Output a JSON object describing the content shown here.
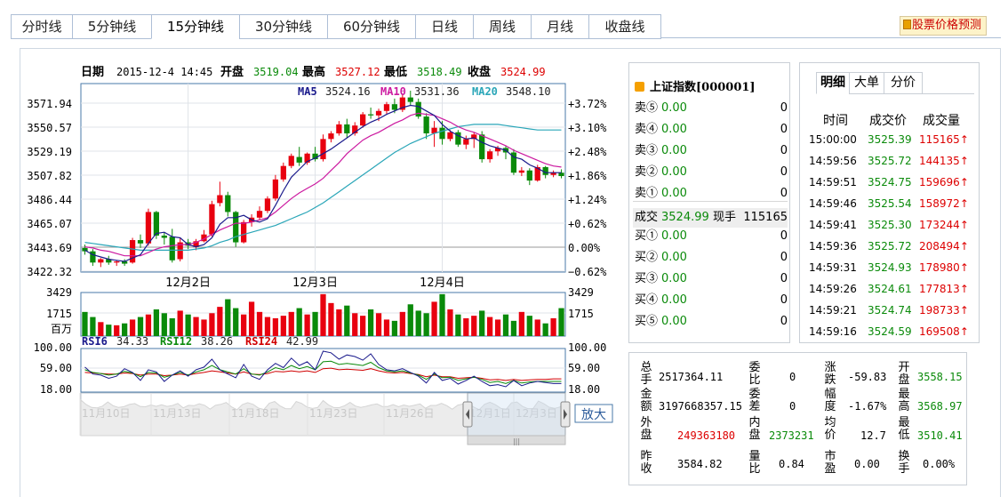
{
  "tabs": [
    "分时线",
    "5分钟线",
    "15分钟线",
    "30分钟线",
    "60分钟线",
    "日线",
    "周线",
    "月线",
    "收盘线"
  ],
  "active_tab": 2,
  "predict_link": "股票价格预测",
  "header": {
    "date_label": "日期",
    "date_value": "2015-12-4 14:45",
    "open_label": "开盘",
    "open_value": "3519.04",
    "high_label": "最高",
    "high_value": "3527.12",
    "low_label": "最低",
    "low_value": "3518.49",
    "close_label": "收盘",
    "close_value": "3524.99"
  },
  "ma_legend": [
    {
      "name": "MA5",
      "value": "3524.16",
      "color": "#1a1a8c"
    },
    {
      "name": "MA10",
      "value": "3531.36",
      "color": "#cc1aa0"
    },
    {
      "name": "MA20",
      "value": "3548.10",
      "color": "#2aa6b8"
    }
  ],
  "rsi_legend": [
    {
      "name": "RSI6",
      "value": "34.33",
      "color": "#1a1a8c"
    },
    {
      "name": "RSI12",
      "value": "38.26",
      "color": "#0a8a0a"
    },
    {
      "name": "RSI24",
      "value": "42.99",
      "color": "#d00000"
    }
  ],
  "colors": {
    "up": "#e8000f",
    "down": "#0a8a0a",
    "grid": "#dfe3e8",
    "frame": "#4a7aa8",
    "zero": "#999999"
  },
  "chart_data": [
    {
      "type": "candlestick",
      "name": "price",
      "y_ticks": [
        "3571.94",
        "3550.57",
        "3529.19",
        "3507.82",
        "3486.44",
        "3465.07",
        "3443.69",
        "3422.32"
      ],
      "y_ticks_right": [
        "+3.72%",
        "+3.10%",
        "+2.48%",
        "+1.86%",
        "+1.24%",
        "+0.62%",
        "0.00%",
        "−0.62%"
      ],
      "ylim": [
        3422.32,
        3571.94
      ],
      "x_labels": [
        {
          "label": "12月2日",
          "index": 13
        },
        {
          "label": "12月3日",
          "index": 29
        },
        {
          "label": "12月4日",
          "index": 45
        }
      ],
      "prev_close": 3443.69,
      "ohlc": [
        [
          3443,
          3446,
          3437,
          3440
        ],
        [
          3440,
          3442,
          3427,
          3430
        ],
        [
          3430,
          3434,
          3426,
          3433
        ],
        [
          3433,
          3436,
          3428,
          3430
        ],
        [
          3430,
          3432,
          3427,
          3431
        ],
        [
          3431,
          3433,
          3427,
          3429
        ],
        [
          3430,
          3452,
          3429,
          3450
        ],
        [
          3450,
          3455,
          3443,
          3447
        ],
        [
          3447,
          3478,
          3445,
          3475
        ],
        [
          3475,
          3476,
          3451,
          3454
        ],
        [
          3454,
          3457,
          3446,
          3452
        ],
        [
          3453,
          3460,
          3430,
          3432
        ],
        [
          3433,
          3452,
          3431,
          3448
        ],
        [
          3448,
          3451,
          3442,
          3445
        ],
        [
          3444,
          3451,
          3441,
          3449
        ],
        [
          3449,
          3459,
          3448,
          3455
        ],
        [
          3455,
          3485,
          3453,
          3482
        ],
        [
          3483,
          3502,
          3480,
          3490
        ],
        [
          3490,
          3493,
          3471,
          3475
        ],
        [
          3475,
          3476,
          3444,
          3448
        ],
        [
          3448,
          3468,
          3447,
          3466
        ],
        [
          3466,
          3473,
          3462,
          3470
        ],
        [
          3470,
          3480,
          3468,
          3476
        ],
        [
          3476,
          3489,
          3474,
          3487
        ],
        [
          3487,
          3508,
          3485,
          3504
        ],
        [
          3504,
          3519,
          3502,
          3516
        ],
        [
          3516,
          3527,
          3514,
          3525
        ],
        [
          3524,
          3533,
          3516,
          3519
        ],
        [
          3519,
          3528,
          3517,
          3527
        ],
        [
          3527,
          3533,
          3520,
          3522
        ],
        [
          3522,
          3544,
          3520,
          3540
        ],
        [
          3540,
          3547,
          3537,
          3545
        ],
        [
          3545,
          3556,
          3543,
          3553
        ],
        [
          3553,
          3558,
          3541,
          3545
        ],
        [
          3545,
          3555,
          3543,
          3552
        ],
        [
          3552,
          3564,
          3550,
          3562
        ],
        [
          3562,
          3568,
          3558,
          3561
        ],
        [
          3561,
          3567,
          3556,
          3565
        ],
        [
          3565,
          3573,
          3562,
          3571
        ],
        [
          3571,
          3576,
          3563,
          3566
        ],
        [
          3566,
          3580,
          3564,
          3577
        ],
        [
          3577,
          3583,
          3570,
          3573
        ],
        [
          3573,
          3576,
          3558,
          3560
        ],
        [
          3560,
          3563,
          3540,
          3545
        ],
        [
          3545,
          3556,
          3533,
          3550
        ],
        [
          3550,
          3556,
          3535,
          3540
        ],
        [
          3540,
          3548,
          3538,
          3546
        ],
        [
          3546,
          3548,
          3533,
          3535
        ],
        [
          3535,
          3543,
          3531,
          3540
        ],
        [
          3540,
          3546,
          3532,
          3544
        ],
        [
          3544,
          3547,
          3519,
          3522
        ],
        [
          3522,
          3531,
          3519,
          3529
        ],
        [
          3529,
          3534,
          3525,
          3532
        ],
        [
          3532,
          3534,
          3522,
          3528
        ],
        [
          3528,
          3531,
          3508,
          3510
        ],
        [
          3510,
          3515,
          3507,
          3512
        ],
        [
          3512,
          3514,
          3499,
          3503
        ],
        [
          3503,
          3517,
          3502,
          3515
        ],
        [
          3515,
          3516,
          3505,
          3508
        ],
        [
          3508,
          3512,
          3506,
          3510
        ],
        [
          3510,
          3513,
          3505,
          3507
        ]
      ],
      "ma5": [
        3441,
        3437,
        3435,
        3433,
        3432,
        3431,
        3434,
        3437,
        3447,
        3456,
        3457,
        3453,
        3452,
        3446,
        3444,
        3446,
        3452,
        3464,
        3470,
        3470,
        3472,
        3468,
        3466,
        3469,
        3481,
        3494,
        3506,
        3513,
        3520,
        3523,
        3527,
        3531,
        3536,
        3541,
        3546,
        3551,
        3555,
        3558,
        3562,
        3565,
        3568,
        3570,
        3569,
        3565,
        3561,
        3553,
        3547,
        3543,
        3540,
        3541,
        3537,
        3534,
        3532,
        3530,
        3524,
        3522,
        3517,
        3514,
        3510,
        3510,
        3510
      ],
      "ma10": [
        3444,
        3443,
        3441,
        3440,
        3438,
        3436,
        3436,
        3436,
        3439,
        3442,
        3444,
        3445,
        3446,
        3446,
        3448,
        3451,
        3455,
        3459,
        3462,
        3465,
        3465,
        3466,
        3468,
        3470,
        3475,
        3481,
        3487,
        3492,
        3496,
        3500,
        3505,
        3512,
        3519,
        3527,
        3533,
        3539,
        3543,
        3546,
        3550,
        3554,
        3557,
        3561,
        3563,
        3562,
        3561,
        3558,
        3555,
        3551,
        3548,
        3546,
        3543,
        3540,
        3537,
        3534,
        3530,
        3527,
        3524,
        3521,
        3518,
        3516,
        3515
      ],
      "ma20": [
        3448,
        3447,
        3446,
        3445,
        3444,
        3443,
        3442,
        3441,
        3441,
        3441,
        3441,
        3441,
        3441,
        3441,
        3442,
        3443,
        3445,
        3448,
        3450,
        3453,
        3455,
        3457,
        3459,
        3461,
        3463,
        3466,
        3469,
        3472,
        3475,
        3479,
        3483,
        3488,
        3493,
        3498,
        3503,
        3508,
        3513,
        3518,
        3523,
        3528,
        3532,
        3536,
        3539,
        3542,
        3545,
        3547,
        3549,
        3551,
        3552,
        3553,
        3553,
        3553,
        3553,
        3552,
        3551,
        3550,
        3549,
        3548,
        3548,
        3548,
        3548
      ]
    },
    {
      "type": "bar",
      "name": "volume",
      "y_ticks": [
        "3429",
        "1715",
        "百万"
      ],
      "ylim": [
        0,
        3429
      ],
      "values": [
        1900,
        1500,
        1100,
        900,
        850,
        1000,
        1300,
        1500,
        1700,
        2100,
        1800,
        1400,
        2000,
        1700,
        1500,
        1300,
        1800,
        2300,
        2900,
        2200,
        1700,
        2700,
        1900,
        1500,
        1400,
        1600,
        1900,
        2200,
        1700,
        1900,
        3300,
        2600,
        2100,
        2400,
        1800,
        1600,
        2100,
        1800,
        1300,
        1200,
        1900,
        2500,
        2000,
        1800,
        2700,
        3300,
        2100,
        1700,
        1400,
        1600,
        2000,
        1500,
        1300,
        1700,
        1200,
        1900,
        1600,
        1300,
        1000,
        1400,
        2200
      ]
    },
    {
      "type": "line",
      "name": "rsi",
      "y_ticks": [
        "100.00",
        "59.00",
        "18.00"
      ],
      "ylim": [
        18,
        100
      ],
      "series": [
        {
          "name": "RSI6",
          "values": [
            65,
            52,
            50,
            44,
            48,
            62,
            55,
            40,
            60,
            56,
            38,
            50,
            58,
            48,
            60,
            65,
            80,
            60,
            52,
            45,
            70,
            48,
            42,
            60,
            72,
            64,
            82,
            68,
            75,
            60,
            95,
            92,
            80,
            88,
            85,
            78,
            90,
            70,
            60,
            58,
            62,
            55,
            48,
            35,
            55,
            40,
            44,
            33,
            40,
            48,
            38,
            30,
            32,
            28,
            40,
            30,
            35,
            38,
            36,
            34,
            34
          ]
        },
        {
          "name": "RSI12",
          "values": [
            60,
            55,
            53,
            50,
            52,
            57,
            54,
            47,
            55,
            54,
            46,
            50,
            55,
            50,
            56,
            60,
            68,
            60,
            56,
            52,
            62,
            52,
            50,
            56,
            64,
            60,
            68,
            62,
            66,
            60,
            75,
            76,
            70,
            72,
            70,
            68,
            74,
            64,
            58,
            56,
            58,
            54,
            50,
            42,
            52,
            45,
            46,
            40,
            43,
            46,
            42,
            36,
            38,
            34,
            40,
            35,
            37,
            38,
            38,
            38,
            38
          ]
        },
        {
          "name": "RSI24",
          "values": [
            55,
            54,
            53,
            52,
            52,
            54,
            53,
            50,
            52,
            52,
            49,
            50,
            52,
            50,
            53,
            55,
            58,
            56,
            54,
            52,
            56,
            52,
            51,
            53,
            57,
            56,
            58,
            56,
            58,
            55,
            62,
            63,
            60,
            61,
            60,
            59,
            62,
            58,
            55,
            54,
            55,
            53,
            51,
            47,
            50,
            47,
            47,
            44,
            45,
            46,
            44,
            41,
            42,
            40,
            42,
            40,
            41,
            42,
            42,
            43,
            43
          ]
        }
      ]
    },
    {
      "type": "area",
      "name": "navigator",
      "x_labels": [
        "11月10日",
        "11月13日",
        "11月18日",
        "11月23日",
        "11月26日",
        "12月1日",
        "12月3日"
      ],
      "zoom_button": "放大"
    }
  ],
  "quote": {
    "title": "上证指数[000001]",
    "sell": [
      {
        "label": "卖⑤",
        "price": "0.00",
        "vol": "0"
      },
      {
        "label": "卖④",
        "price": "0.00",
        "vol": "0"
      },
      {
        "label": "卖③",
        "price": "0.00",
        "vol": "0"
      },
      {
        "label": "卖②",
        "price": "0.00",
        "vol": "0"
      },
      {
        "label": "卖①",
        "price": "0.00",
        "vol": "0"
      }
    ],
    "deal": {
      "label": "成交",
      "price": "3524.99",
      "now_label": "现手",
      "vol": "115165"
    },
    "buy": [
      {
        "label": "买①",
        "price": "0.00",
        "vol": "0"
      },
      {
        "label": "买②",
        "price": "0.00",
        "vol": "0"
      },
      {
        "label": "买③",
        "price": "0.00",
        "vol": "0"
      },
      {
        "label": "买④",
        "price": "0.00",
        "vol": "0"
      },
      {
        "label": "买⑤",
        "price": "0.00",
        "vol": "0"
      }
    ]
  },
  "trades": {
    "tabs": [
      "明细",
      "大单",
      "分价"
    ],
    "headers": [
      "时间",
      "成交价",
      "成交量"
    ],
    "rows": [
      {
        "time": "15:00:00",
        "price": "3525.39",
        "vol": "115165"
      },
      {
        "time": "14:59:56",
        "price": "3525.72",
        "vol": "144135"
      },
      {
        "time": "14:59:51",
        "price": "3524.75",
        "vol": "159696"
      },
      {
        "time": "14:59:46",
        "price": "3525.54",
        "vol": "158972"
      },
      {
        "time": "14:59:41",
        "price": "3525.30",
        "vol": "173244"
      },
      {
        "time": "14:59:36",
        "price": "3525.72",
        "vol": "208494"
      },
      {
        "time": "14:59:31",
        "price": "3524.93",
        "vol": "178980"
      },
      {
        "time": "14:59:26",
        "price": "3524.61",
        "vol": "177813"
      },
      {
        "time": "14:59:21",
        "price": "3524.74",
        "vol": "198733"
      },
      {
        "time": "14:59:16",
        "price": "3524.59",
        "vol": "169508"
      }
    ]
  },
  "stats": {
    "zongshou_label": "总手",
    "zongshou": "2517364.11",
    "jine_label": "金额",
    "jine": "3197668357.15",
    "waipan_label": "外盘",
    "waipan": "249363180",
    "zuoshou_label": "昨收",
    "zuoshou": "3584.82",
    "weibi_label": "委比",
    "weibi": "0",
    "weicha_label": "委差",
    "weicha": "0",
    "neipan_label": "内盘",
    "neipan": "2373231",
    "liangbi_label": "量比",
    "liangbi": "0.84",
    "zhangdie_label": "涨跌",
    "zhangdie": "-59.83",
    "fudu_label": "幅度",
    "fudu": "-1.67%",
    "junjia_label": "均价",
    "junjia": "12.7",
    "shiying_label": "市盈",
    "shiying": "0.00",
    "kaipan_label": "开盘",
    "kaipan": "3558.15",
    "zuigao_label": "最高",
    "zuigao": "3568.97",
    "zuidi_label": "最低",
    "zuidi": "3510.41",
    "huanshou_label": "换手",
    "huanshou": "0.00%"
  }
}
